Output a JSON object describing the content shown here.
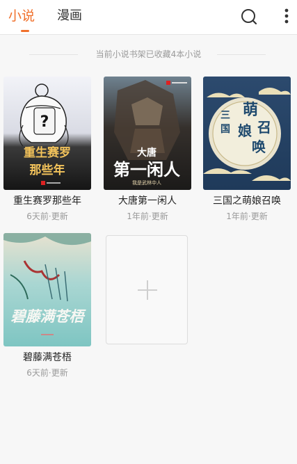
{
  "header": {
    "tabs": [
      {
        "label": "小说",
        "active": true
      },
      {
        "label": "漫画",
        "active": false
      }
    ],
    "accent_color": "#f0702b",
    "icons": [
      "search-icon",
      "more-vertical-icon"
    ]
  },
  "shelf": {
    "summary": "当前小说书架已收藏4本小说"
  },
  "books": [
    {
      "title": "重生赛罗那些年",
      "updated": "6天前·更新",
      "cover_text": "重生赛罗那些年",
      "cover_icon": "question-mark-avatar"
    },
    {
      "title": "大唐第一闲人",
      "updated": "1年前·更新",
      "cover_text_top": "大唐",
      "cover_text_main": "第一闲人",
      "cover_sub": "我是武林中人"
    },
    {
      "title": "三国之萌娘召唤",
      "updated": "1年前·更新",
      "cover_text": "三国萌娘召唤"
    },
    {
      "title": "碧藤满苍梧",
      "updated": "6天前·更新",
      "cover_text": "碧藤满苍梧"
    }
  ],
  "add_book": {
    "icon": "plus-icon"
  }
}
